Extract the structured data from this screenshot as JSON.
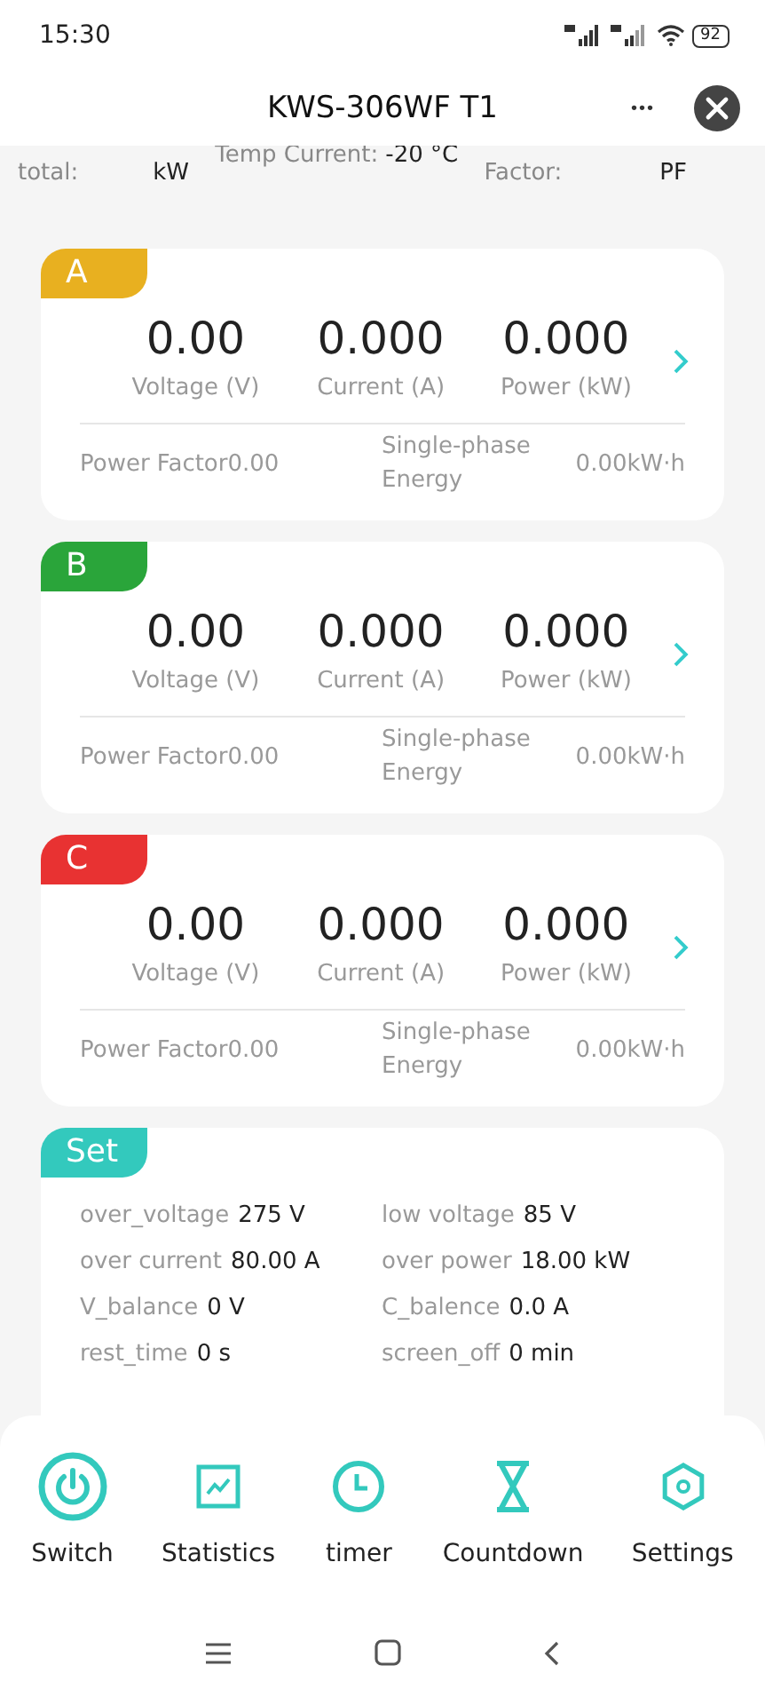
{
  "status_bar": {
    "time": "15:30",
    "battery": "92"
  },
  "header": {
    "title": "KWS-306WF T1",
    "more": "•••"
  },
  "summary": [
    {
      "label": "total:",
      "value": "kW"
    },
    {
      "label": "Temp Current:",
      "value": "-20 °C"
    },
    {
      "label": "Factor:",
      "value": "PF"
    }
  ],
  "phases": [
    {
      "name": "A",
      "color": "#e8b020",
      "voltage": "0.00",
      "current": "0.000",
      "power": "0.000",
      "voltage_label": "Voltage (V)",
      "current_label": "Current (A)",
      "power_label": "Power (kW)",
      "power_factor": "Power Factor0.00",
      "energy_label": "Single-phase Energy",
      "energy": "0.00kW·h"
    },
    {
      "name": "B",
      "color": "#2aa53a",
      "voltage": "0.00",
      "current": "0.000",
      "power": "0.000",
      "voltage_label": "Voltage (V)",
      "current_label": "Current (A)",
      "power_label": "Power (kW)",
      "power_factor": "Power Factor0.00",
      "energy_label": "Single-phase Energy",
      "energy": "0.00kW·h"
    },
    {
      "name": "C",
      "color": "#e83232",
      "voltage": "0.00",
      "current": "0.000",
      "power": "0.000",
      "voltage_label": "Voltage (V)",
      "current_label": "Current (A)",
      "power_label": "Power (kW)",
      "power_factor": "Power Factor0.00",
      "energy_label": "Single-phase Energy",
      "energy": "0.00kW·h"
    }
  ],
  "settings": {
    "title": "Set",
    "items": [
      {
        "label": "over_voltage",
        "value": "275 V"
      },
      {
        "label": "low voltage",
        "value": "85 V"
      },
      {
        "label": "over current",
        "value": "80.00 A"
      },
      {
        "label": "over power",
        "value": "18.00 kW"
      },
      {
        "label": "V_balance",
        "value": "0 V"
      },
      {
        "label": "C_balence",
        "value": "0.0 A"
      },
      {
        "label": "rest_time",
        "value": "0 s"
      },
      {
        "label": "screen_off",
        "value": "0 min"
      }
    ]
  },
  "bottom_nav": [
    {
      "kind": "power",
      "label": "Switch"
    },
    {
      "kind": "chart",
      "label": "Statistics"
    },
    {
      "kind": "clock",
      "label": "timer"
    },
    {
      "kind": "hourglass",
      "label": "Countdown"
    },
    {
      "kind": "hexagon",
      "label": "Settings"
    }
  ]
}
